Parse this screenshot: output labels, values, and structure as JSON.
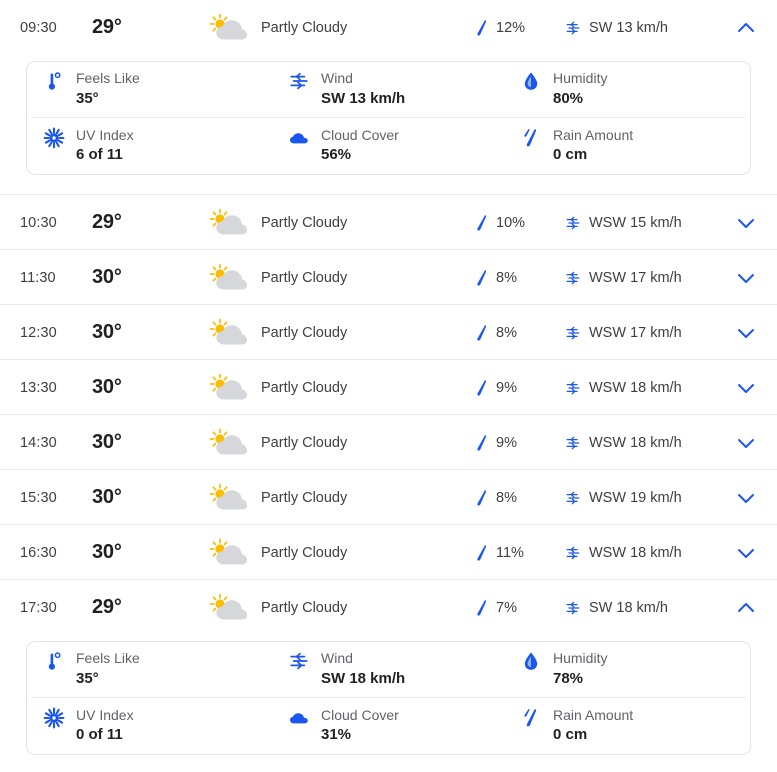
{
  "units": {
    "degree": "°",
    "speed": "km/h"
  },
  "colors": {
    "accent_blue": "#1a56db",
    "icon_blue": "#1a56f0",
    "sun_yellow": "#fbbc04",
    "cloud_grey": "#d5d7da",
    "text_primary": "#202124",
    "text_secondary": "#5f6368",
    "divider": "#e8eaed"
  },
  "detail_labels": {
    "feels_like": "Feels Like",
    "wind": "Wind",
    "humidity": "Humidity",
    "uv_index": "UV Index",
    "cloud_cover": "Cloud Cover",
    "rain_amount": "Rain Amount"
  },
  "icons": {
    "condition": "partly-cloudy-icon",
    "precipitation": "raindrop-icon",
    "wind": "wind-icon",
    "expand": "chevron-down-icon",
    "collapse": "chevron-up-icon",
    "feels_like": "thermometer-icon",
    "humidity": "water-drop-icon",
    "uv_index": "sun-burst-icon",
    "cloud_cover": "cloud-icon",
    "rain_amount": "rain-drops-icon"
  },
  "hours": [
    {
      "time": "09:30",
      "temp": "29°",
      "condition": "Partly Cloudy",
      "precip": "12%",
      "wind": "SW 13 km/h",
      "expanded": true,
      "details": {
        "feels_like": "35°",
        "wind": "SW 13 km/h",
        "humidity": "80%",
        "uv_index": "6 of 11",
        "cloud_cover": "56%",
        "rain_amount": "0 cm"
      }
    },
    {
      "time": "10:30",
      "temp": "29°",
      "condition": "Partly Cloudy",
      "precip": "10%",
      "wind": "WSW 15 km/h",
      "expanded": false
    },
    {
      "time": "11:30",
      "temp": "30°",
      "condition": "Partly Cloudy",
      "precip": "8%",
      "wind": "WSW 17 km/h",
      "expanded": false
    },
    {
      "time": "12:30",
      "temp": "30°",
      "condition": "Partly Cloudy",
      "precip": "8%",
      "wind": "WSW 17 km/h",
      "expanded": false
    },
    {
      "time": "13:30",
      "temp": "30°",
      "condition": "Partly Cloudy",
      "precip": "9%",
      "wind": "WSW 18 km/h",
      "expanded": false
    },
    {
      "time": "14:30",
      "temp": "30°",
      "condition": "Partly Cloudy",
      "precip": "9%",
      "wind": "WSW 18 km/h",
      "expanded": false
    },
    {
      "time": "15:30",
      "temp": "30°",
      "condition": "Partly Cloudy",
      "precip": "8%",
      "wind": "WSW 19 km/h",
      "expanded": false
    },
    {
      "time": "16:30",
      "temp": "30°",
      "condition": "Partly Cloudy",
      "precip": "11%",
      "wind": "WSW 18 km/h",
      "expanded": false
    },
    {
      "time": "17:30",
      "temp": "29°",
      "condition": "Partly Cloudy",
      "precip": "7%",
      "wind": "SW 18 km/h",
      "expanded": true,
      "details": {
        "feels_like": "35°",
        "wind": "SW 18 km/h",
        "humidity": "78%",
        "uv_index": "0 of 11",
        "cloud_cover": "31%",
        "rain_amount": "0 cm"
      }
    }
  ]
}
